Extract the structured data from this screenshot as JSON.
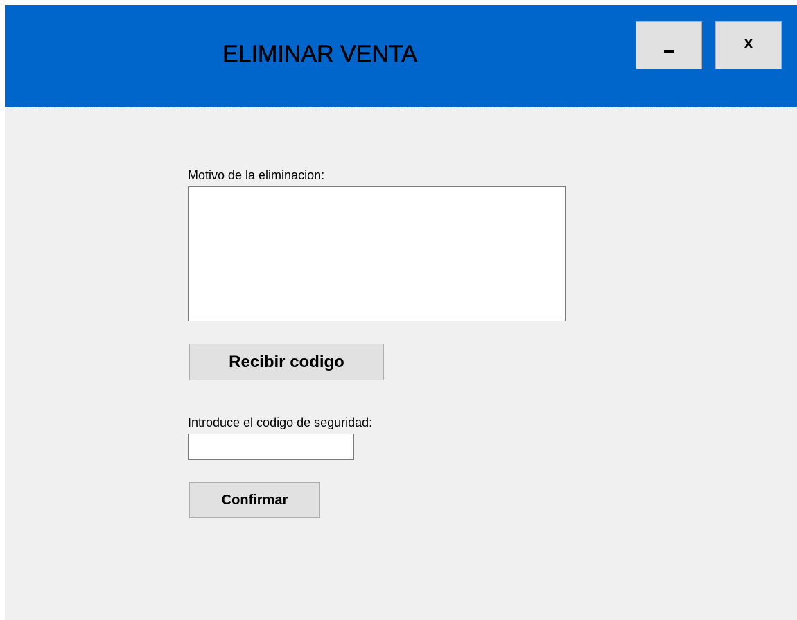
{
  "window": {
    "title": "ELIMINAR VENTA",
    "minimize_icon": "minimize-icon",
    "close_label": "x",
    "accent_color": "#0066cc",
    "background_color": "#f0f0f0"
  },
  "form": {
    "motivo_label": "Motivo de la eliminacion:",
    "motivo_value": "",
    "recibir_button_label": "Recibir codigo",
    "codigo_label": "Introduce el codigo de seguridad:",
    "codigo_value": "",
    "confirmar_button_label": "Confirmar"
  }
}
